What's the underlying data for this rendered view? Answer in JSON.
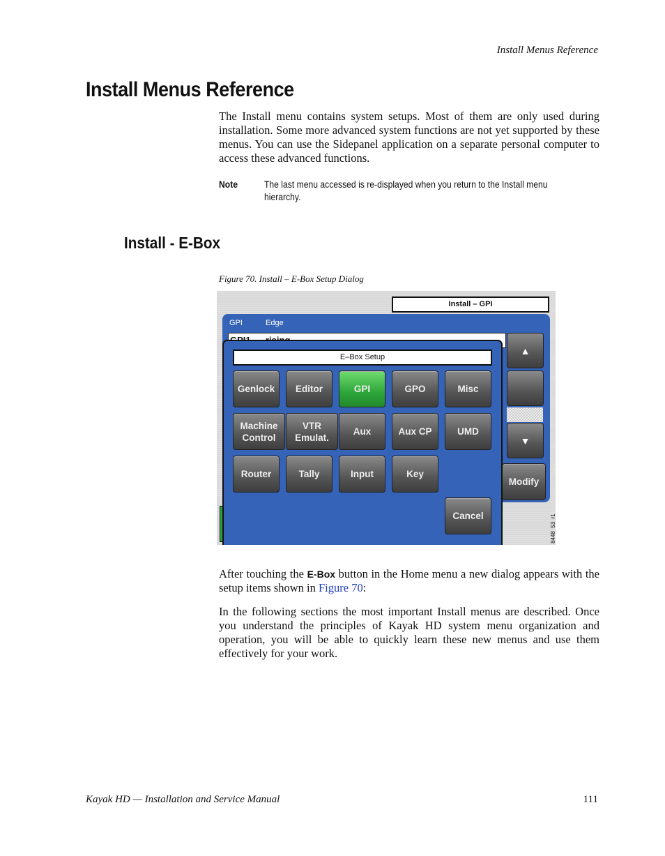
{
  "header": {
    "running_title": "Install Menus Reference"
  },
  "title": "Install Menus Reference",
  "intro": "The Install menu contains system setups. Most of them are only used during installation. Some more advanced system functions are not yet supported by these menus. You can use the Sidepanel application on a separate personal computer to access these advanced functions.",
  "note": {
    "label": "Note",
    "text": "The last menu accessed is re-displayed when you return to the Install menu hierarchy."
  },
  "section_title": "Install - E-Box",
  "figure": {
    "caption": "Figure 70.  Install – E-Box Setup Dialog",
    "background_title": "Install – GPI",
    "columns": [
      "GPI",
      "Edge"
    ],
    "row": [
      "GPI1",
      "rising"
    ],
    "modify": "Modify",
    "scroll_up_icon": "triangle-up",
    "scroll_down_icon": "triangle-down",
    "dialog_title": "E–Box Setup",
    "buttons": [
      "Genlock",
      "Editor",
      "GPI",
      "GPO",
      "Misc",
      "Machine Control",
      "VTR Emulat.",
      "Aux",
      "Aux CP",
      "UMD",
      "Router",
      "Tally",
      "Input",
      "Key"
    ],
    "selected": "GPI",
    "cancel": "Cancel",
    "figure_id": "8448_53_r1",
    "colors": {
      "panel": "#3563b8",
      "selected": "#2ea53a"
    }
  },
  "para1": {
    "before": "After touching the ",
    "button": "E-Box",
    "middle": " button in the Home menu a new dialog appears with the setup items shown in ",
    "link": "Figure 70",
    "after": ":"
  },
  "para2": "In the following sections the most important Install menus are described. Once you understand the principles of Kayak HD system menu organization and operation, you will be able to quickly learn these new menus and use them effectively for your work.",
  "footer": {
    "left": "Kayak HD  —  Installation and Service Manual",
    "page": "111"
  }
}
